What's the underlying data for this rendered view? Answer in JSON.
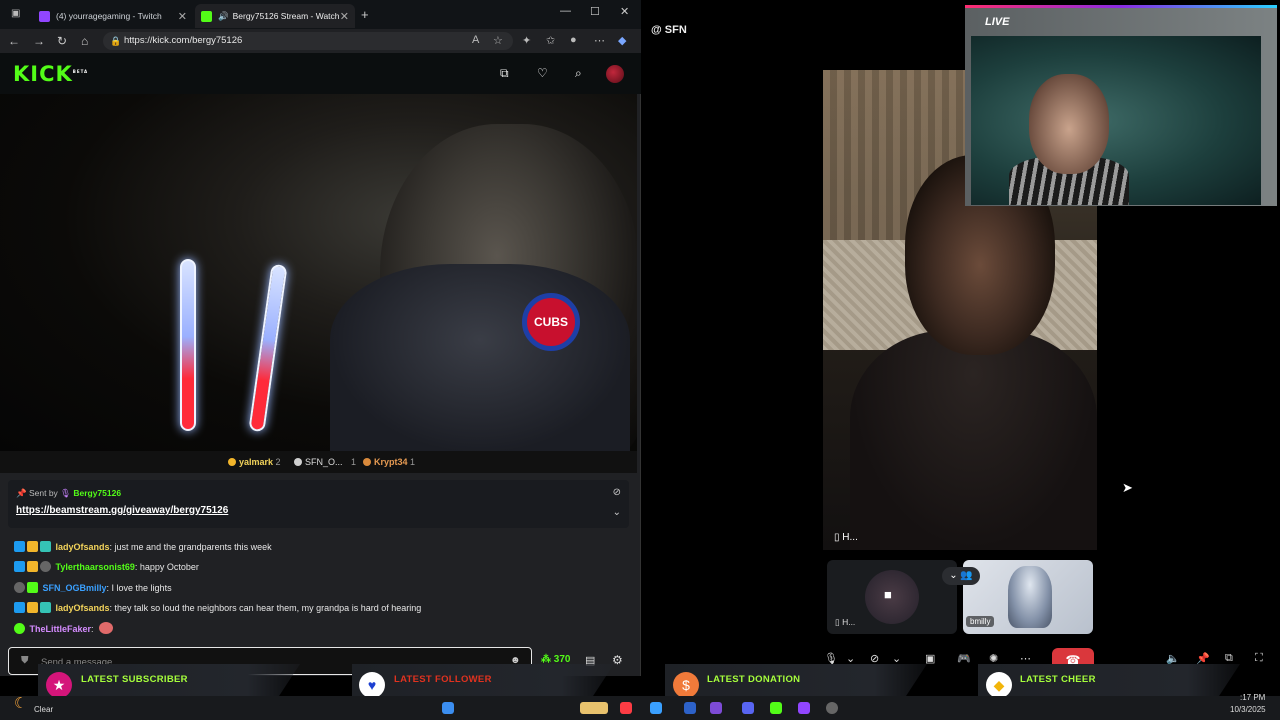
{
  "browser": {
    "tabs": [
      {
        "title": "(4) yourragegaming - Twitch"
      },
      {
        "title": "Bergy75126 Stream - Watch"
      }
    ],
    "url": "https://kick.com/bergy75126"
  },
  "kick": {
    "logo": "KICK",
    "logo_badge": "BETA",
    "leaderboard": [
      {
        "name": "yalmark",
        "count": "2"
      },
      {
        "name": "SFN_O...",
        "count": "1"
      },
      {
        "name": "Krypt34",
        "count": "1"
      }
    ],
    "pinned": {
      "sent_by_label": "Sent by",
      "sender": "Bergy75126",
      "link": "https://beamstream.gg/giveaway/bergy75126"
    },
    "messages": [
      {
        "user": "ladyOfsands",
        "text": ": just me and the grandparents this week",
        "color": "#f2d35b"
      },
      {
        "user": "Tylerthaarsonist69",
        "text": ": happy October",
        "color": "#53fc18"
      },
      {
        "user": "SFN_OGBmilly",
        "text": ": I love the lights",
        "color": "#3aa0ff"
      },
      {
        "user": "ladyOfsands",
        "text": ": they talk so loud the neighbors can hear them, my grandpa is hard of hearing",
        "color": "#f2d35b"
      },
      {
        "user": "TheLittleFaker",
        "text": ":",
        "color": "#d58cff"
      }
    ],
    "input_placeholder": "Send a message",
    "points": "370",
    "video_patch": "CUBS"
  },
  "discord": {
    "channel": "SFN",
    "main_label": "H...",
    "tile_a_label": "H...",
    "tile_b_label": "bmilly"
  },
  "webcam": {
    "badge": "LIVE"
  },
  "overlay": {
    "latest_subscriber": "LATEST SUBSCRIBER",
    "latest_follower": "LATEST FOLLOWER",
    "latest_donation": "LATEST DONATION",
    "latest_cheer": "LATEST CHEER"
  },
  "taskbar": {
    "weather": "Clear",
    "time": ":17 PM",
    "date": "10/3/2025"
  }
}
